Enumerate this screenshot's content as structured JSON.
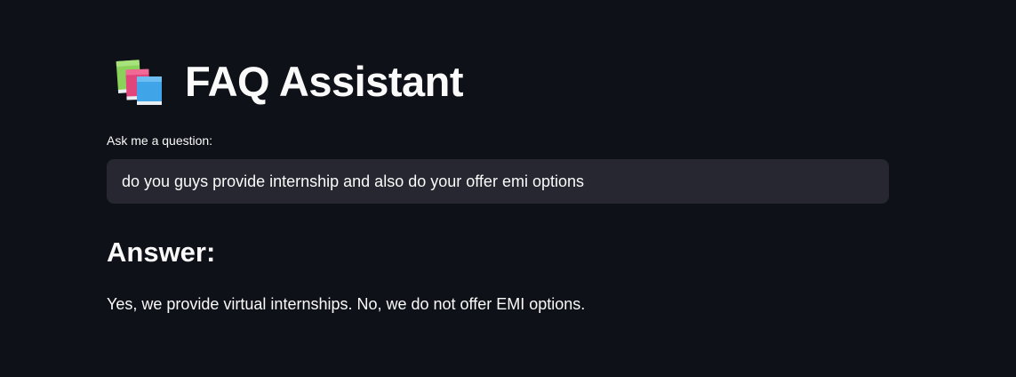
{
  "header": {
    "icon": "books-icon",
    "title": "FAQ Assistant"
  },
  "question": {
    "label": "Ask me a question:",
    "value": "do you guys provide internship and also do your offer emi options"
  },
  "answer": {
    "heading": "Answer:",
    "text": "Yes, we provide virtual internships. No, we do not offer EMI options."
  },
  "colors": {
    "background": "#0e1117",
    "input_background": "#262730",
    "text": "#fafafa"
  }
}
